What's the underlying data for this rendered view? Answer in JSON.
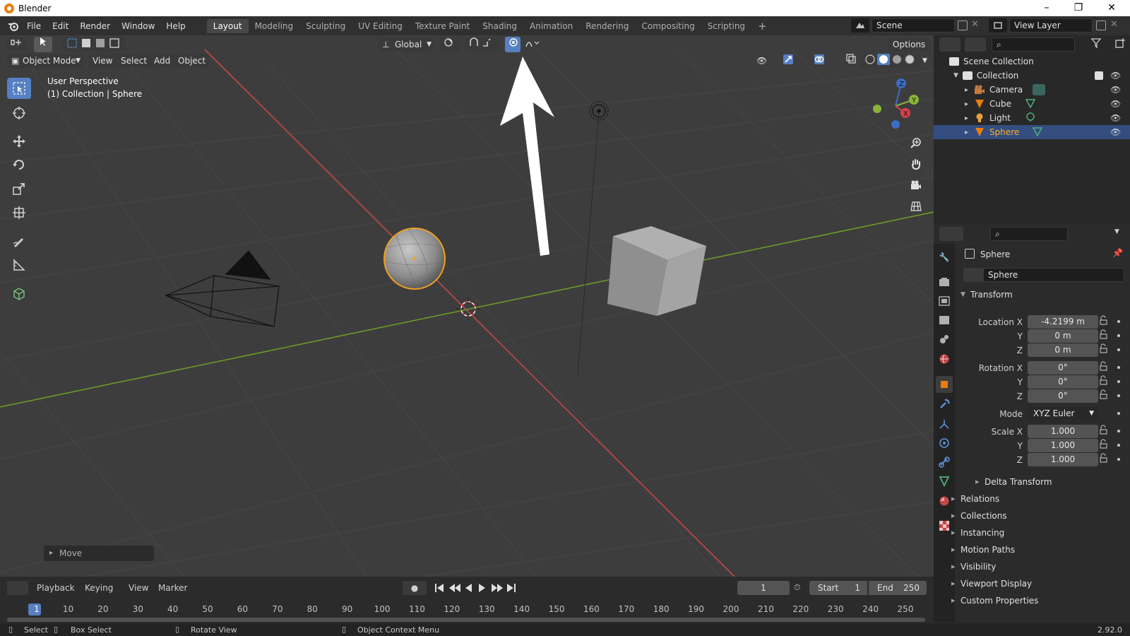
{
  "window": {
    "title": "Blender",
    "minimize": "–",
    "maximize": "❐",
    "close": "✕"
  },
  "menu": {
    "items": [
      "File",
      "Edit",
      "Render",
      "Window",
      "Help"
    ]
  },
  "workspaces": [
    "Layout",
    "Modeling",
    "Sculpting",
    "UV Editing",
    "Texture Paint",
    "Shading",
    "Animation",
    "Rendering",
    "Compositing",
    "Scripting"
  ],
  "add_workspace": "+",
  "scene": {
    "name": "Scene",
    "view_layer": "View Layer"
  },
  "viewport": {
    "mode": "Object Mode",
    "menus": [
      "View",
      "Select",
      "Add",
      "Object"
    ],
    "transform_orientation": "Global",
    "options_label": "Options",
    "perspective_label": "User Perspective",
    "collection_label": "(1) Collection | Sphere",
    "last_operator": "Move"
  },
  "outliner": {
    "root": "Scene Collection",
    "collection": "Collection",
    "items": [
      {
        "name": "Camera",
        "color": "#c77b3b"
      },
      {
        "name": "Cube",
        "color": "#e87d0d"
      },
      {
        "name": "Light",
        "color": "#e8a23a"
      },
      {
        "name": "Sphere",
        "color": "#e87d0d"
      }
    ],
    "selected": "Sphere"
  },
  "properties": {
    "object_name": "Sphere",
    "data_name": "Sphere",
    "transform_title": "Transform",
    "location": {
      "label": "Location X",
      "x": "-4.2199 m",
      "y": "0 m",
      "z": "0 m"
    },
    "rotation": {
      "label": "Rotation X",
      "x": "0°",
      "y": "0°",
      "z": "0°"
    },
    "mode": {
      "label": "Mode",
      "value": "XYZ Euler"
    },
    "scale": {
      "label": "Scale X",
      "x": "1.000",
      "y": "1.000",
      "z": "1.000"
    },
    "axis_labels": {
      "y": "Y",
      "z": "Z"
    },
    "delta_transform": "Delta Transform",
    "sections": [
      "Relations",
      "Collections",
      "Instancing",
      "Motion Paths",
      "Visibility",
      "Viewport Display",
      "Custom Properties"
    ]
  },
  "timeline": {
    "menus": [
      "Playback",
      "Keying",
      "View",
      "Marker"
    ],
    "current_frame": "1",
    "start_label": "Start",
    "start": "1",
    "end_label": "End",
    "end": "250",
    "ruler": [
      "1",
      "10",
      "20",
      "30",
      "40",
      "50",
      "60",
      "70",
      "80",
      "90",
      "100",
      "110",
      "120",
      "130",
      "140",
      "150",
      "160",
      "170",
      "180",
      "190",
      "200",
      "210",
      "220",
      "230",
      "240",
      "250"
    ]
  },
  "statusbar": {
    "select": "Select",
    "box_select": "Box Select",
    "rotate_view": "Rotate View",
    "context_menu": "Object Context Menu",
    "version": "2.92.0"
  }
}
